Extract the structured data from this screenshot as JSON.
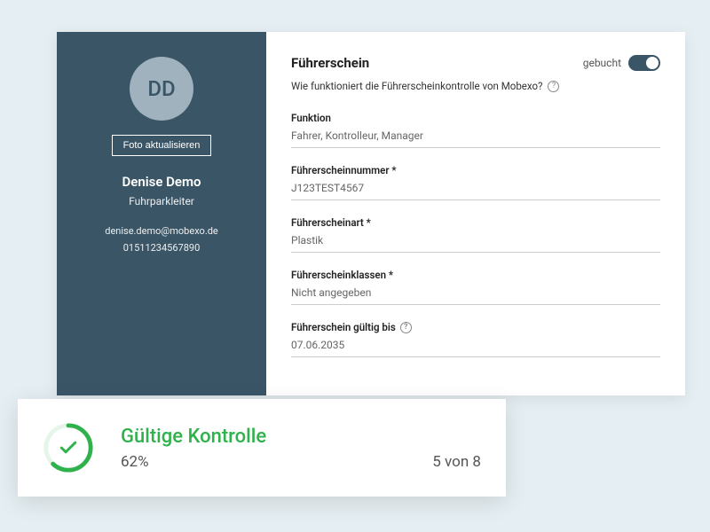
{
  "sidebar": {
    "avatar_initials": "DD",
    "photo_button": "Foto aktualisieren",
    "name": "Denise Demo",
    "role": "Fuhrparkleiter",
    "email": "denise.demo@mobexo.de",
    "phone": "01511234567890"
  },
  "main": {
    "title": "Führerschein",
    "toggle_label": "gebucht",
    "help_text": "Wie funktioniert die Führerscheinkontrolle von Mobexo?",
    "fields": [
      {
        "label": "Funktion",
        "value": "Fahrer, Kontrolleur, Manager"
      },
      {
        "label": "Führerscheinnummer *",
        "value": "J123TEST4567"
      },
      {
        "label": "Führerscheinart *",
        "value": "Plastik"
      },
      {
        "label": "Führerscheinklassen *",
        "value": "Nicht angegeben"
      },
      {
        "label": "Führerschein gültig bis",
        "value": "07.06.2035",
        "help": true
      }
    ]
  },
  "status": {
    "title": "Gültige Kontrolle",
    "percent": "62%",
    "count": "5 von 8",
    "arc_percent": 62
  },
  "colors": {
    "sidebar_bg": "#3a5666",
    "accent_green": "#2fb24c"
  }
}
